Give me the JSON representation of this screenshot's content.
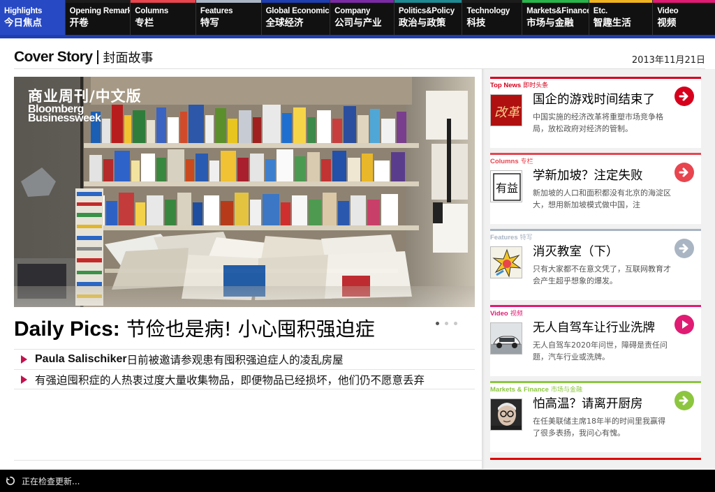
{
  "nav": {
    "items": [
      {
        "en": "Highlights",
        "zh": "今日焦点",
        "color": "#2749c4"
      },
      {
        "en": "Opening Remarks",
        "zh": "开卷",
        "color": "#1c1c1c"
      },
      {
        "en": "Columns",
        "zh": "专栏",
        "color": "#e8454f"
      },
      {
        "en": "Features",
        "zh": "特写",
        "color": "#a9b5c3"
      },
      {
        "en": "Global Economics",
        "zh": "全球经济",
        "color": "#1f3fb0"
      },
      {
        "en": "Company",
        "zh": "公司与产业",
        "color": "#7a2aa2"
      },
      {
        "en": "Politics&Policy",
        "zh": "政治与政策",
        "color": "#1f8a92"
      },
      {
        "en": "Technology",
        "zh": "科技",
        "color": "#1c1c1c"
      },
      {
        "en": "Markets&Finance",
        "zh": "市场与金融",
        "color": "#29b54a"
      },
      {
        "en": "Etc.",
        "zh": "智趣生活",
        "color": "#f0b21f"
      },
      {
        "en": "Video",
        "zh": "视频",
        "color": "#e01b74"
      }
    ]
  },
  "header": {
    "brand_en": "Cover Story",
    "brand_zh": "封面故事",
    "date": "2013年11月21日"
  },
  "hero": {
    "logo_zh": "商业周刊/中文版",
    "logo_en_1": "Bloomberg",
    "logo_en_2": "Businessweek"
  },
  "story": {
    "headline_en": "Daily Pics:",
    "headline_zh": "节俭也是病! 小心囤积强迫症",
    "bullet_1_strong": "Paula Salischiker",
    "bullet_1_text": "日前被邀请参观患有囤积强迫症人的凌乱房屋",
    "bullet_2_text": "有强迫囤积症的人热衷过度大量收集物品，即便物品已经损坏，他们仍不愿意丢弃"
  },
  "cards": [
    {
      "label_en": "Top News",
      "label_zh": "即时头条",
      "title": "国企的游戏时间结束了",
      "desc": "中国实施的经济改革将重塑市场竞争格局，放松政府对经济的管制。",
      "color": "#d6001c",
      "icon": "arrow-right"
    },
    {
      "label_en": "Columns",
      "label_zh": "专栏",
      "title": "学新加坡？注定失败",
      "desc": "新加坡的人口和面积都没有北京的海淀区大，想用新加坡模式做中国，注",
      "color": "#e8454f",
      "icon": "arrow-right"
    },
    {
      "label_en": "Features",
      "label_zh": "特写",
      "title": "消灭教室（下）",
      "desc": "只有大家都不在意文凭了，互联网教育才会产生超乎想象的爆发。",
      "color": "#a9b5c3",
      "icon": "arrow-right"
    },
    {
      "label_en": "Video",
      "label_zh": "视频",
      "title": "无人自驾车让行业洗牌",
      "desc": "无人自驾车2020年问世，障碍是责任问题，汽车行业或洗牌。",
      "color": "#e01b74",
      "icon": "play"
    },
    {
      "label_en": "Markets & Finance",
      "label_zh": "市场与金融",
      "title": "怕高温？请离开厨房",
      "desc": "在任美联储主席18年半的时间里我赢得了很多表扬，我问心有愧。",
      "color": "#8cc63f",
      "icon": "arrow-right"
    }
  ],
  "thumbs": {
    "t1_text": "改革",
    "t2_text": "有益"
  },
  "status": {
    "text": "正在检查更新..."
  }
}
